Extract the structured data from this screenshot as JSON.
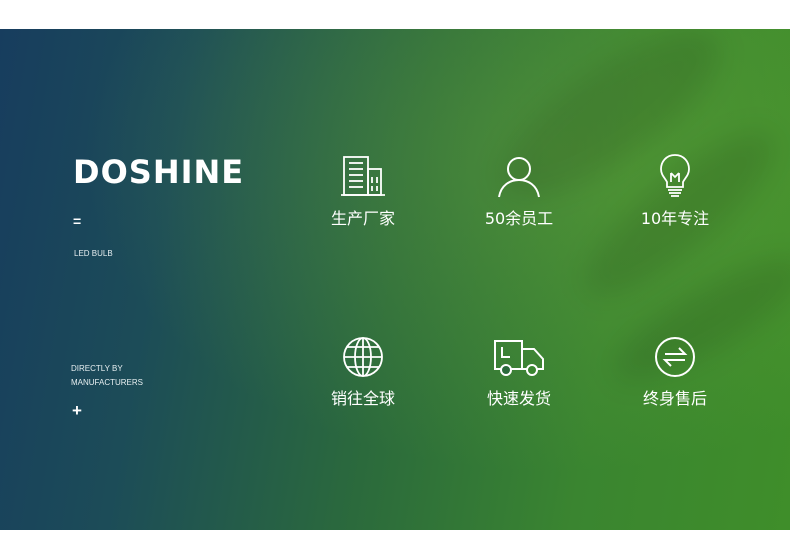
{
  "brand": {
    "name": "DOSHINE",
    "equals": "=",
    "subtitle": "LED BULB",
    "direct_line1": "DIRECTLY BY",
    "direct_line2": "MANUFACTURERS",
    "plus": "+"
  },
  "features": [
    {
      "label": "生产厂家",
      "icon": "factory-building-icon"
    },
    {
      "label": "50余员工",
      "icon": "person-icon"
    },
    {
      "label": "10年专注",
      "icon": "light-bulb-icon"
    },
    {
      "label": "销往全球",
      "icon": "globe-icon"
    },
    {
      "label": "快速发货",
      "icon": "delivery-truck-icon"
    },
    {
      "label": "终身售后",
      "icon": "exchange-arrows-icon"
    }
  ],
  "colors": {
    "gradient_left": "#173d5e",
    "gradient_right": "#3f8e2a",
    "text": "#ffffff"
  }
}
